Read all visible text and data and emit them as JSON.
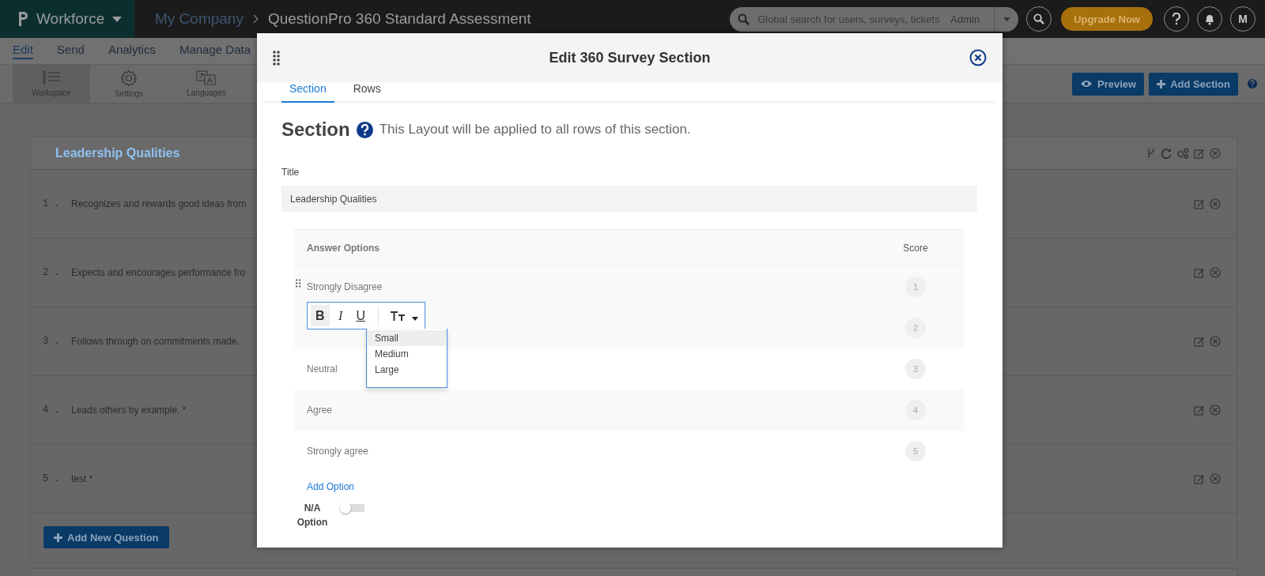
{
  "top_bar": {
    "app_name": "Workforce",
    "breadcrumb": [
      {
        "label": "My Company"
      },
      {
        "label": "QuestionPro 360 Standard Assessment"
      }
    ],
    "search": {
      "placeholder": "Global search for users, surveys, tickets",
      "scope": "Admin"
    },
    "upgrade_button": "Upgrade Now",
    "avatar": "M"
  },
  "menu": [
    {
      "label": "Edit",
      "selected": true
    },
    {
      "label": "Send",
      "selected": false
    },
    {
      "label": "Analytics",
      "selected": false
    },
    {
      "label": "Manage Data",
      "selected": false
    }
  ],
  "toolbar": [
    {
      "label": "Workspace",
      "kind": "workspace",
      "selected": true
    },
    {
      "label": "Settings",
      "kind": "settings",
      "selected": false
    },
    {
      "label": "Languages",
      "kind": "languages",
      "selected": false
    }
  ],
  "actions": [
    {
      "label": "Preview",
      "kind": "preview"
    },
    {
      "label": "Add Section",
      "kind": "add"
    }
  ],
  "section_card": {
    "title": "Leadership Qualities",
    "questions": [
      {
        "number": "1 .",
        "text": "Recognizes and rewards good ideas from"
      },
      {
        "number": "2 .",
        "text": "Expects and encourages performance fro"
      },
      {
        "number": "3 .",
        "text": "Follows through on commitments made."
      },
      {
        "number": "4 .",
        "text": "Leads others by example. *"
      },
      {
        "number": "5 .",
        "text": "test *"
      }
    ],
    "add_button": "Add New Question"
  },
  "modal": {
    "title": "Edit 360 Survey Section",
    "tabs": [
      {
        "label": "Section",
        "selected": true
      },
      {
        "label": "Rows",
        "selected": false
      }
    ],
    "heading": "Section",
    "description": "This Layout will be applied to all rows of this section.",
    "title_label": "Title",
    "title_value": "Leadership Qualities",
    "table": {
      "columns": [
        "Answer Options",
        "Score"
      ],
      "rows": [
        {
          "option": "Strongly Disagree",
          "score": "1"
        },
        {
          "score": "2"
        },
        {
          "option": "Neutral",
          "score": "3"
        },
        {
          "option": "Agree",
          "score": "4"
        },
        {
          "option": "Strongly agree",
          "score": "5"
        }
      ]
    },
    "format_toolbar": {
      "buttons": [
        {
          "kind": "bold",
          "label": "B",
          "selected": true
        },
        {
          "kind": "italic",
          "label": "I",
          "selected": false
        },
        {
          "kind": "underline",
          "label": "U",
          "selected": false
        }
      ],
      "size_menu": [
        {
          "label": "Small",
          "selected": true
        },
        {
          "label": "Medium",
          "selected": false
        },
        {
          "label": "Large",
          "selected": false
        }
      ]
    },
    "add_option": "Add Option",
    "na_option": {
      "label": "N/A Option",
      "on": false
    }
  }
}
